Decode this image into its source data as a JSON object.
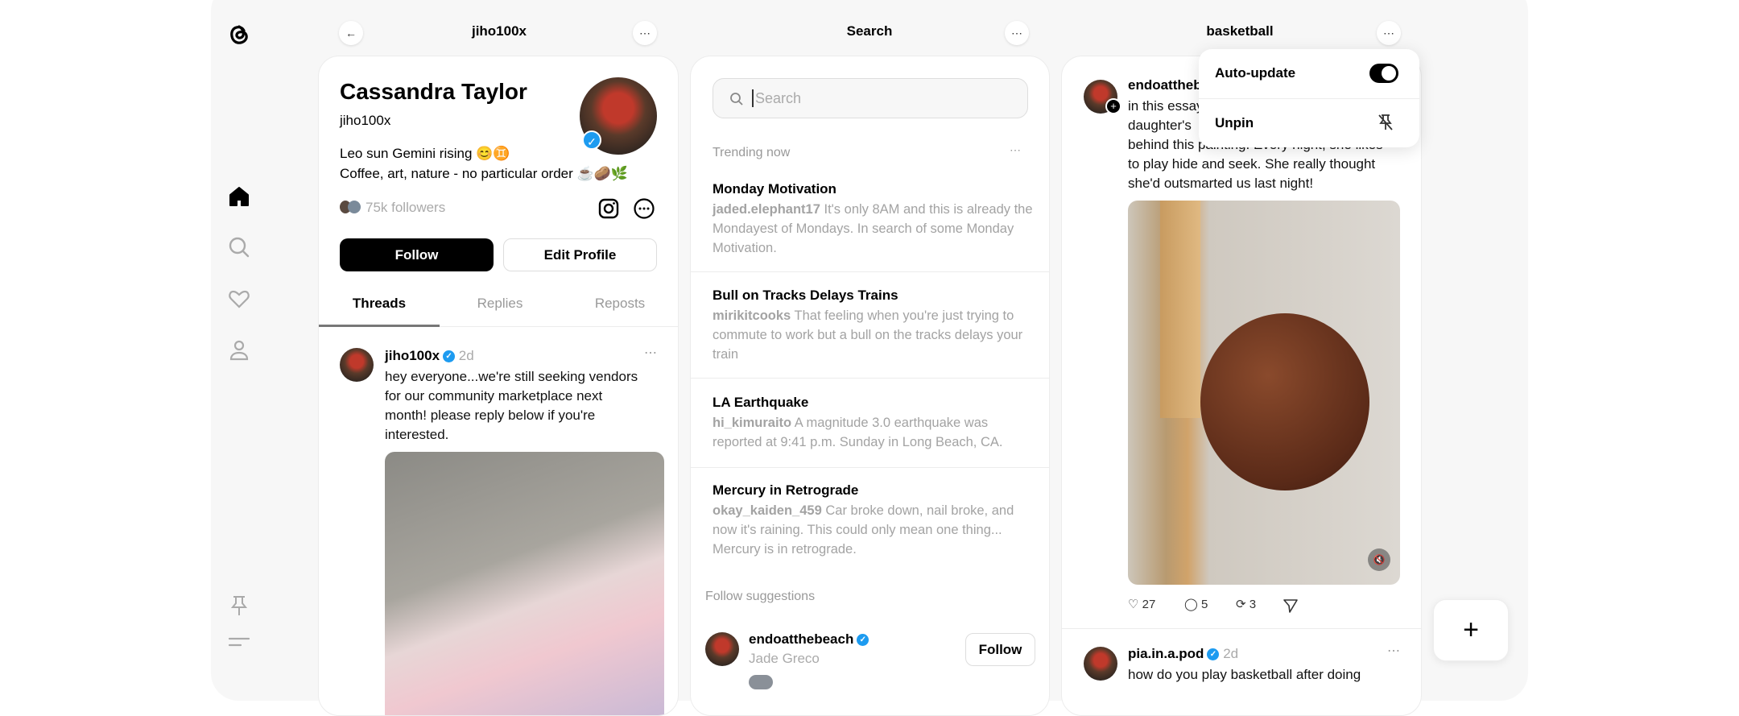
{
  "sidebar": {
    "items": [
      {
        "icon": "home-icon",
        "active": true
      },
      {
        "icon": "search-icon"
      },
      {
        "icon": "heart-icon"
      },
      {
        "icon": "profile-icon"
      }
    ],
    "bottom": [
      {
        "icon": "pin-icon"
      },
      {
        "icon": "menu-icon"
      }
    ]
  },
  "profile_column": {
    "header": "jiho100x",
    "name": "Cassandra Taylor",
    "handle": "jiho100x",
    "bio_line1": "Leo sun Gemini rising 😊♊",
    "bio_line2": "Coffee, art, nature - no particular order ☕🥔🌿",
    "followers": "75k followers",
    "follow_label": "Follow",
    "edit_label": "Edit Profile",
    "tabs": [
      {
        "label": "Threads",
        "active": true
      },
      {
        "label": "Replies"
      },
      {
        "label": "Reposts"
      }
    ],
    "post": {
      "user": "jiho100x",
      "time": "2d",
      "text_lines": [
        "hey everyone...we're still seeking vendors",
        "for our community marketplace next",
        "month! please reply below if you're",
        "interested."
      ]
    }
  },
  "search_column": {
    "header": "Search",
    "search_placeholder": "Search",
    "trending_label": "Trending now",
    "trends": [
      {
        "title": "Monday Motivation",
        "user": "jaded.elephant17",
        "text": "It's only 8AM and this is already the Mondayest of Mondays. In search of some Monday Motivation."
      },
      {
        "title": "Bull on Tracks Delays Trains",
        "user": "mirikitcooks",
        "text": "That feeling when you're just trying to commute to work but a bull on the tracks delays your train"
      },
      {
        "title": "LA Earthquake",
        "user": "hi_kimuraito",
        "text": "A magnitude 3.0 earthquake was reported at 9:41 p.m. Sunday in Long Beach, CA."
      },
      {
        "title": "Mercury in Retrograde",
        "user": "okay_kaiden_459",
        "text": "Car broke down, nail broke, and now it's raining. This could only mean one thing... Mercury is in retrograde."
      }
    ],
    "suggestions_label": "Follow suggestions",
    "suggestion": {
      "user": "endoatthebeach",
      "name": "Jade Greco",
      "follow_label": "Follow"
    }
  },
  "feed_column": {
    "header": "basketball",
    "menu": {
      "auto_update_label": "Auto-update",
      "auto_update_on": true,
      "unpin_label": "Unpin"
    },
    "post1": {
      "user": "endoatthebeach",
      "text_lines": [
        "in this essay",
        "daughter's",
        "behind this painting. Every night, she likes",
        "to play hide and seek. She really thought",
        "she'd outsmarted us last night!"
      ],
      "likes": "27",
      "replies": "5",
      "reposts": "3"
    },
    "post2": {
      "user": "pia.in.a.pod",
      "time": "2d",
      "text": "how do you play basketball after doing"
    }
  },
  "colors": {
    "accent": "#1d9bf0",
    "background": "#f7f7f7",
    "primary_button": "#000000"
  }
}
